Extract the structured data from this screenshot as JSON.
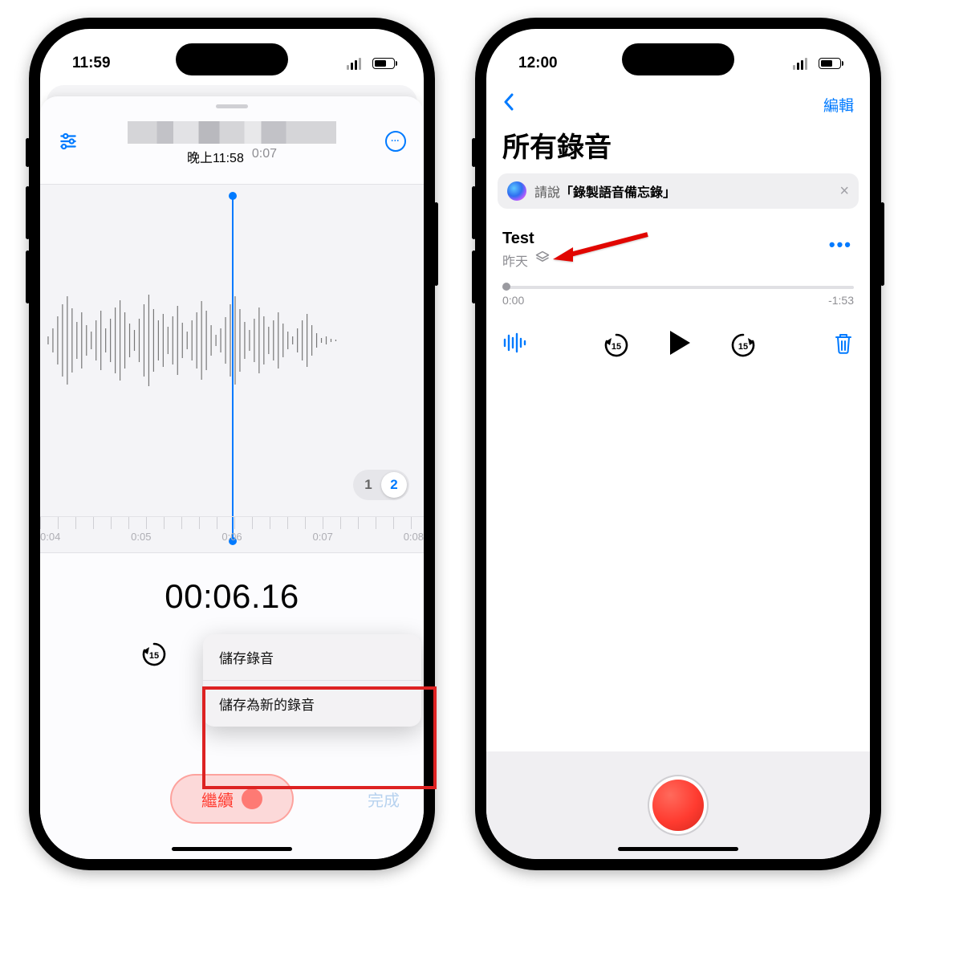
{
  "left": {
    "status_time": "11:59",
    "title_blurred": true,
    "subtitle_time": "晚上11:58",
    "subtitle_dur": "0:07",
    "ruler": [
      "0:04",
      "0:05",
      "0:06",
      "0:07",
      "0:08"
    ],
    "big_time": "00:06.16",
    "layer_1": "1",
    "layer_2": "2",
    "menu": {
      "save": "儲存錄音",
      "save_as_new": "儲存為新的錄音"
    },
    "continue_label": "繼續",
    "done_label": "完成"
  },
  "right": {
    "status_time": "12:00",
    "edit_label": "編輯",
    "page_title": "所有錄音",
    "siri_prefix": "請說",
    "siri_phrase": "「錄製語音備忘錄」",
    "item": {
      "name": "Test",
      "when": "昨天"
    },
    "scrub": {
      "elapsed": "0:00",
      "remaining": "-1:53"
    }
  },
  "icons": {
    "sliders": "sliders-icon",
    "more": "more-icon",
    "back": "chevron-left-icon",
    "layers": "layers-icon",
    "waveform": "waveform-icon",
    "rewind15": "rewind-15-icon",
    "forward15": "forward-15-icon",
    "play": "play-icon",
    "trash": "trash-icon",
    "close": "close-icon",
    "siri": "siri-icon",
    "record": "record-button"
  }
}
